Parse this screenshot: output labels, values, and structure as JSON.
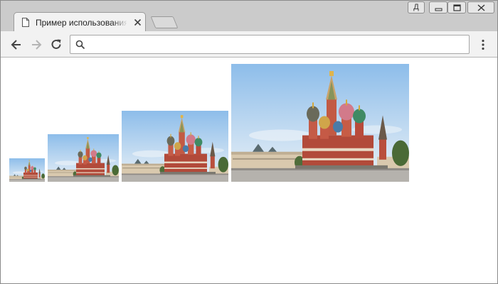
{
  "browser": {
    "tab": {
      "title": "Пример использования атрибута"
    },
    "profile_label": "Д",
    "address": {
      "value": "",
      "placeholder": ""
    }
  },
  "colors": {
    "chrome_frame": "#cbcbcb",
    "toolbar": "#f2f2f2",
    "page_background": "#ffffff",
    "sky": "#9cc6ec",
    "cathedral_red": "#b24a3a"
  },
  "icons": [
    "page-icon",
    "close-icon",
    "back-arrow-icon",
    "forward-arrow-icon",
    "reload-icon",
    "search-icon",
    "menu-dots-icon",
    "minimize-icon",
    "maximize-icon"
  ],
  "content": {
    "images": [
      {
        "subject": "saint-basils-cathedral"
      },
      {
        "subject": "saint-basils-cathedral"
      },
      {
        "subject": "saint-basils-cathedral"
      },
      {
        "subject": "saint-basils-cathedral"
      }
    ]
  }
}
